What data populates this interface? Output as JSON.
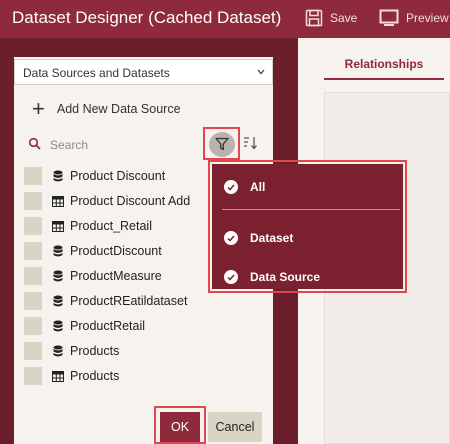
{
  "window": {
    "title": "Dataset Designer (Cached Dataset)",
    "save_label": "Save",
    "preview_label": "Preview"
  },
  "left_panel": {
    "source_select": "Data Sources and Datasets",
    "add_data_source": "Add New Data Source",
    "search_placeholder": "Search",
    "items": [
      {
        "label": "Product Discount",
        "icon": "database-icon"
      },
      {
        "label": "Product Discount Add",
        "icon": "table-icon"
      },
      {
        "label": "Product_Retail",
        "icon": "table-icon"
      },
      {
        "label": "ProductDiscount",
        "icon": "database-icon"
      },
      {
        "label": "ProductMeasure",
        "icon": "database-icon"
      },
      {
        "label": "ProductREatildataset",
        "icon": "database-icon"
      },
      {
        "label": "ProductRetail",
        "icon": "database-icon"
      },
      {
        "label": "Products",
        "icon": "database-icon"
      },
      {
        "label": "Products",
        "icon": "table-icon"
      }
    ]
  },
  "filter_menu": {
    "items": [
      "All",
      "Dataset",
      "Data Source"
    ]
  },
  "right_panel": {
    "tab_label": "Relationships"
  },
  "footer": {
    "ok_label": "OK",
    "cancel_label": "Cancel"
  },
  "colors": {
    "brand": "#8e2a3b",
    "frame": "#6b1f2a",
    "dropdown": "#7b2130",
    "highlight": "#e0484f"
  }
}
